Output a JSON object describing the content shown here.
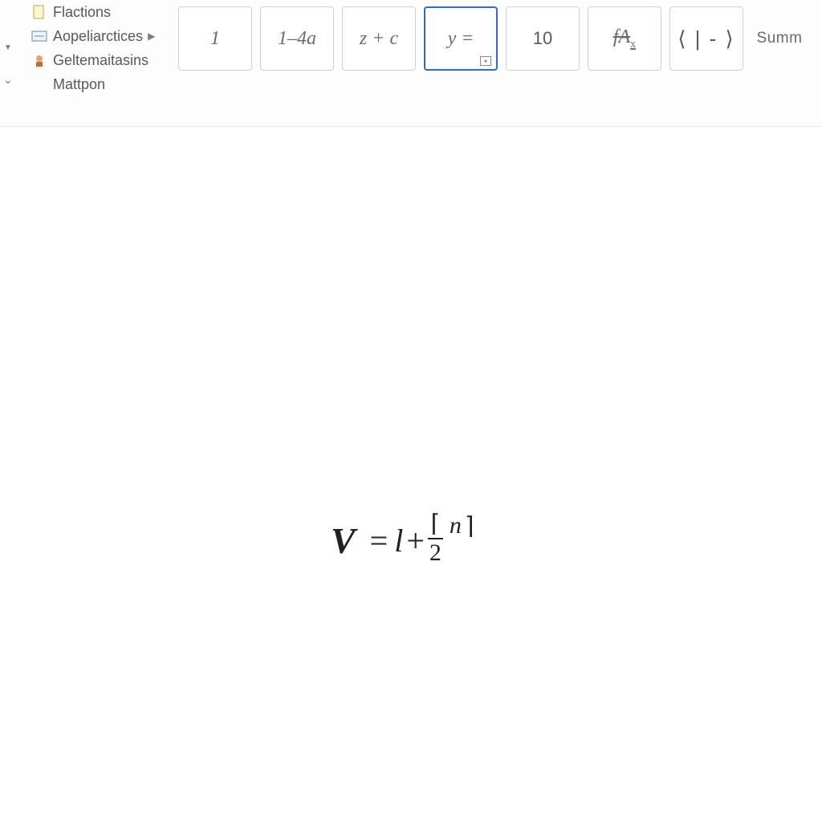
{
  "ribbon": {
    "menu": {
      "item1": "Flactions",
      "item2": "Aopeliarctices",
      "item3": "Geltemaitasins",
      "item4": "Mattpon"
    },
    "gallery": [
      {
        "label": "1"
      },
      {
        "label": "1–4a"
      },
      {
        "label": "z + c"
      },
      {
        "label": "y =",
        "selected": true
      },
      {
        "label": "10"
      },
      {
        "label": "fAₓ"
      },
      {
        "label": "⟨ | - ⟩"
      },
      {
        "label": "Summ"
      }
    ]
  },
  "equation": {
    "lhs": "V",
    "eq": "=",
    "term1": "l",
    "plus": "+",
    "frac_num": "⌈",
    "frac_den": "2",
    "sup": "n",
    "close": "⌉"
  }
}
